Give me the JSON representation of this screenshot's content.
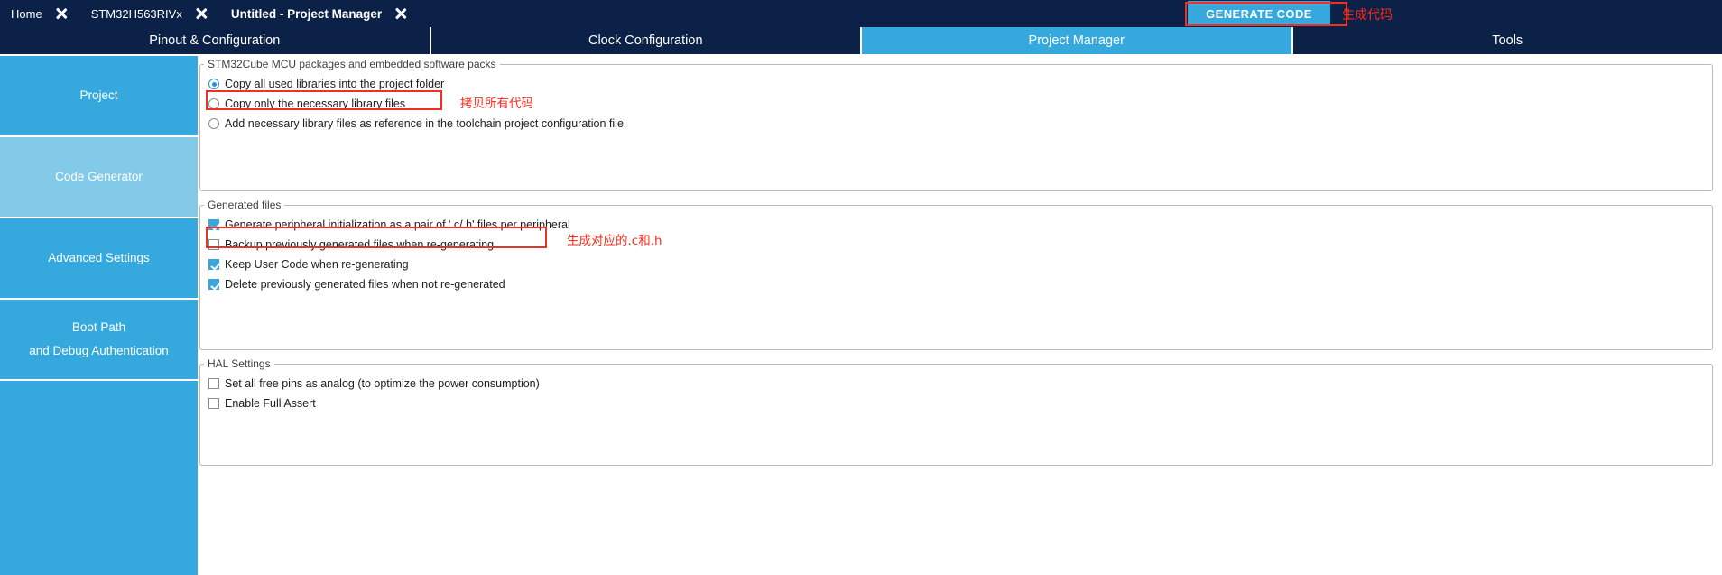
{
  "breadcrumb": {
    "items": [
      {
        "label": "Home",
        "bold": false
      },
      {
        "label": "STM32H563RIVx",
        "bold": false
      },
      {
        "label": "Untitled - Project Manager",
        "bold": true
      }
    ]
  },
  "toolbar": {
    "generate_code_label": "GENERATE CODE",
    "generate_code_annotation": "生成代码",
    "accent_color": "#35a8de",
    "annotation_color": "#ff2a1a"
  },
  "tabs": [
    {
      "label": "Pinout & Configuration",
      "active": false
    },
    {
      "label": "Clock Configuration",
      "active": false
    },
    {
      "label": "Project Manager",
      "active": true
    },
    {
      "label": "Tools",
      "active": false
    }
  ],
  "sidebar": {
    "items": [
      {
        "label": "Project",
        "selected": false
      },
      {
        "label": "Code Generator",
        "selected": true
      },
      {
        "label": "Advanced Settings",
        "selected": false
      },
      {
        "label_line1": "Boot Path",
        "label_line2": "and Debug Authentication",
        "selected": false
      }
    ]
  },
  "sections": {
    "packages": {
      "legend": "STM32Cube MCU packages and embedded software packs",
      "options": [
        {
          "label": "Copy all used libraries into the project folder",
          "selected": true
        },
        {
          "label": "Copy only the necessary library files",
          "selected": false
        },
        {
          "label": "Add necessary library files as reference in the toolchain project configuration file",
          "selected": false
        }
      ],
      "annotation": "拷贝所有代码"
    },
    "generated": {
      "legend": "Generated files",
      "options": [
        {
          "label": "Generate peripheral initialization as a pair of '.c/.h' files per peripheral",
          "checked": true
        },
        {
          "label": "Backup previously generated files when re-generating",
          "checked": false
        },
        {
          "label": "Keep User Code when re-generating",
          "checked": true
        },
        {
          "label": "Delete previously generated files when not re-generated",
          "checked": true
        }
      ],
      "annotation": "生成对应的.c和.h"
    },
    "hal": {
      "legend": "HAL Settings",
      "options": [
        {
          "label": "Set all free pins as analog (to optimize the power consumption)",
          "checked": false
        },
        {
          "label": "Enable Full Assert",
          "checked": false
        }
      ]
    }
  }
}
